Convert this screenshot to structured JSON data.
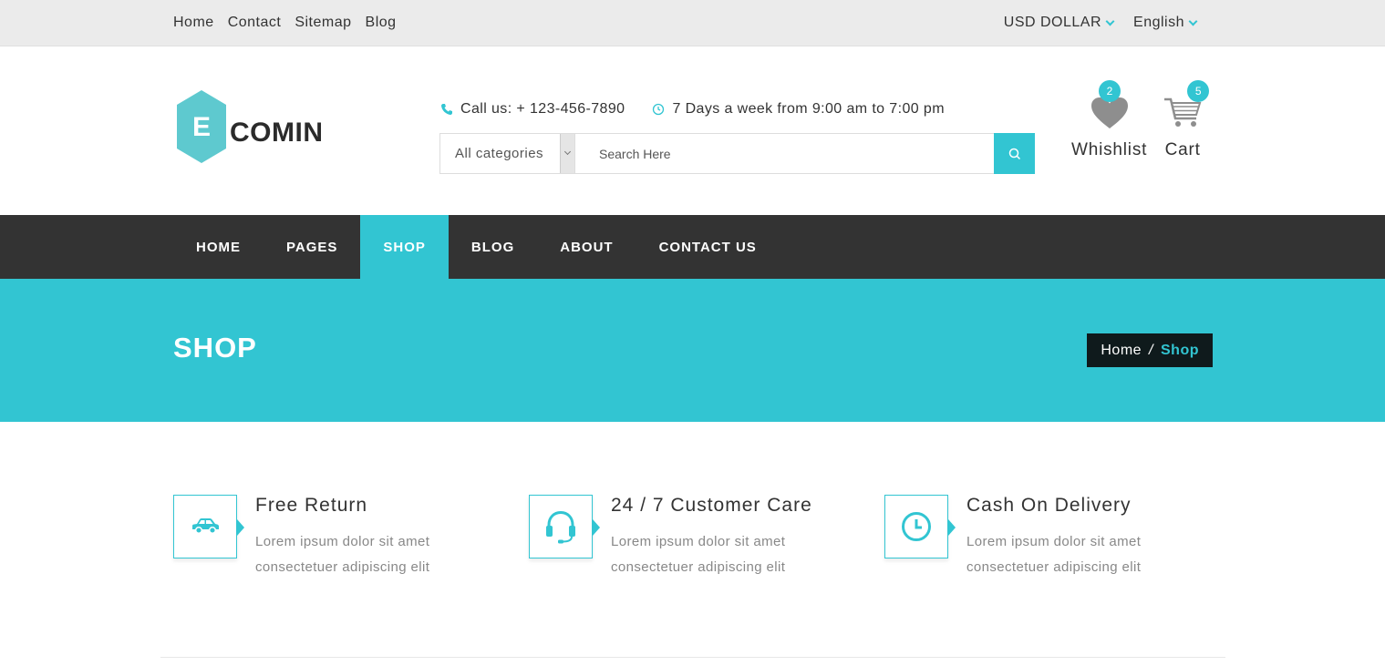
{
  "topbar": {
    "links": [
      "Home",
      "Contact",
      "Sitemap",
      "Blog"
    ],
    "currency": "USD DOLLAR",
    "language": "English"
  },
  "header": {
    "logo_letter": "E",
    "logo_text": "COMIN",
    "phone": "Call us: + 123-456-7890",
    "hours": "7 Days a week from 9:00 am to 7:00 pm",
    "category_selected": "All categories",
    "search_placeholder": "Search Here",
    "wishlist": {
      "label": "Whishlist",
      "count": "2"
    },
    "cart": {
      "label": "Cart",
      "count": "5"
    }
  },
  "nav": {
    "items": [
      "HOME",
      "PAGES",
      "SHOP",
      "BLOG",
      "ABOUT",
      "CONTACT US"
    ],
    "active": "SHOP"
  },
  "banner": {
    "title": "SHOP",
    "breadcrumb_home": "Home",
    "breadcrumb_sep": "/",
    "breadcrumb_current": "Shop"
  },
  "features": [
    {
      "icon": "car-icon",
      "title": "Free Return",
      "desc": "Lorem ipsum dolor sit amet consectetuer adipiscing elit"
    },
    {
      "icon": "headset-icon",
      "title": "24 / 7 Customer Care",
      "desc": "Lorem ipsum dolor sit amet consectetuer adipiscing elit"
    },
    {
      "icon": "clock-icon",
      "title": "Cash On Delivery",
      "desc": "Lorem ipsum dolor sit amet consectetuer adipiscing elit"
    }
  ],
  "colors": {
    "accent": "#32c5d2",
    "nav_bg": "#333333",
    "topbar_bg": "#ebebeb",
    "breadcrumb_bg": "#0f1a1c"
  }
}
